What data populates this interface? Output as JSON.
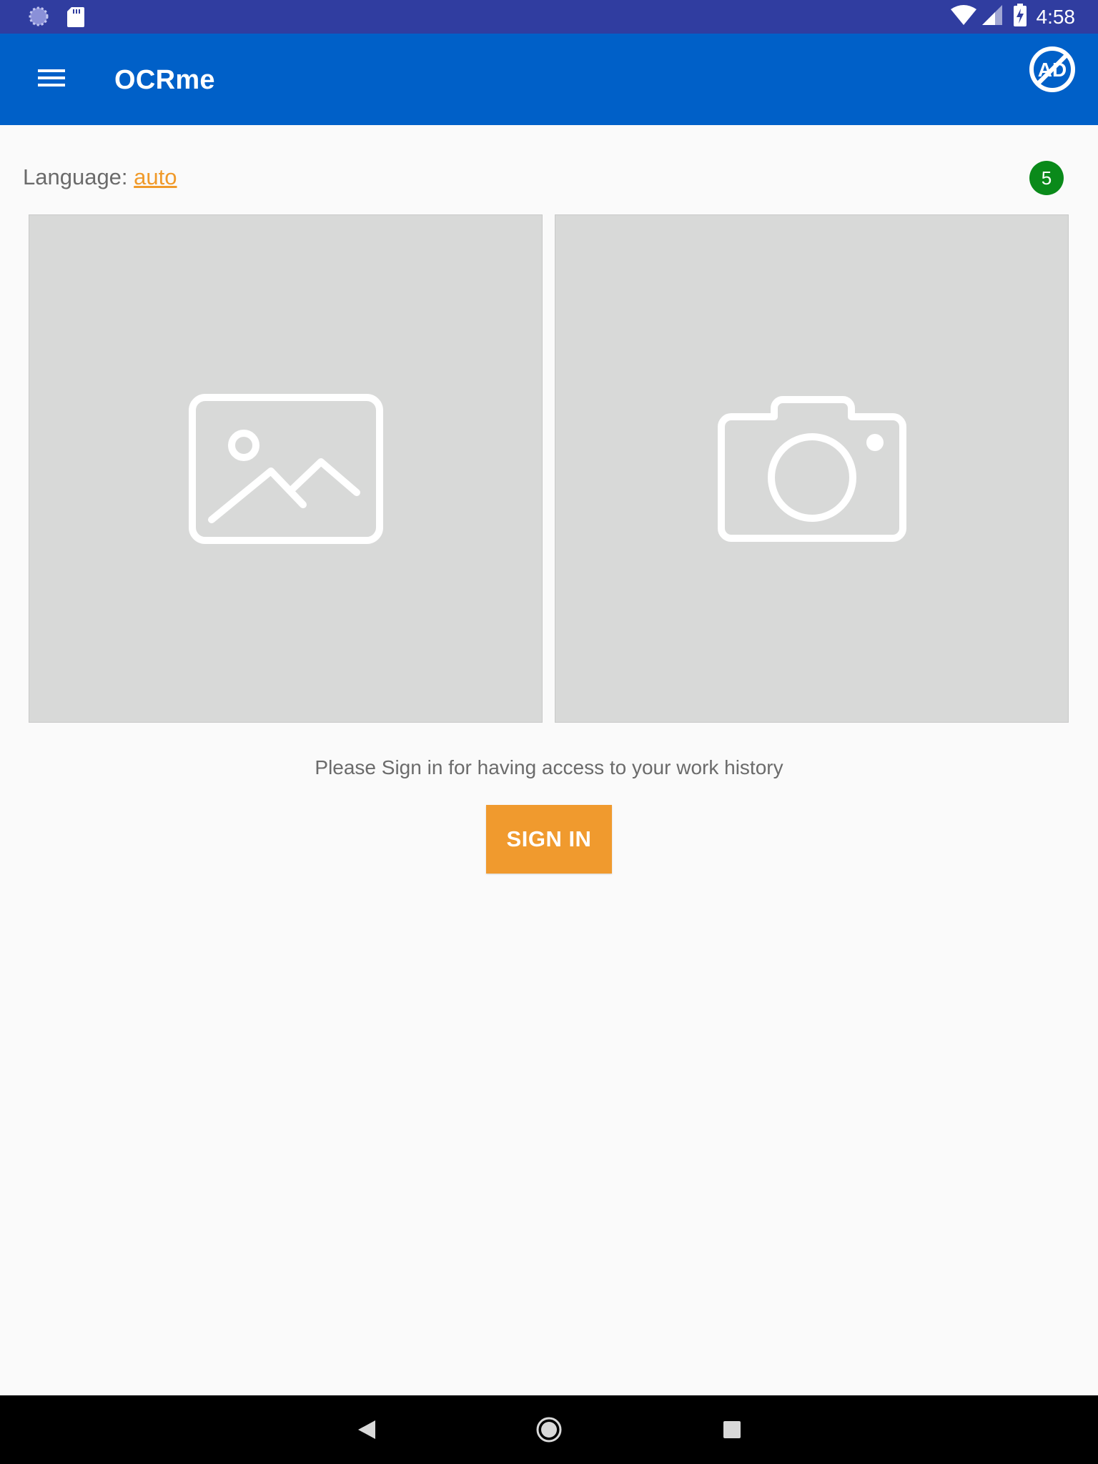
{
  "status_bar": {
    "time": "4:58",
    "left_icons": [
      "loading-icon",
      "sd-card-icon"
    ],
    "right_icons": [
      "wifi-icon",
      "signal-icon",
      "battery-charging-icon"
    ]
  },
  "app_bar": {
    "title": "OCRme",
    "menu_icon": "menu-icon",
    "action_icon": "no-ads-icon",
    "background": "#0060c8"
  },
  "language": {
    "label": "Language:",
    "value": "auto"
  },
  "badge": {
    "count": "5",
    "color": "#0a8a1a"
  },
  "tiles": [
    {
      "name": "gallery",
      "icon": "image-icon"
    },
    {
      "name": "camera",
      "icon": "camera-icon"
    }
  ],
  "signin": {
    "message": "Please Sign in for having access to your work history",
    "button_label": "SIGN IN",
    "button_color": "#f09a2e"
  },
  "nav_bar": {
    "buttons": [
      "back-icon",
      "home-icon",
      "recents-icon"
    ]
  }
}
